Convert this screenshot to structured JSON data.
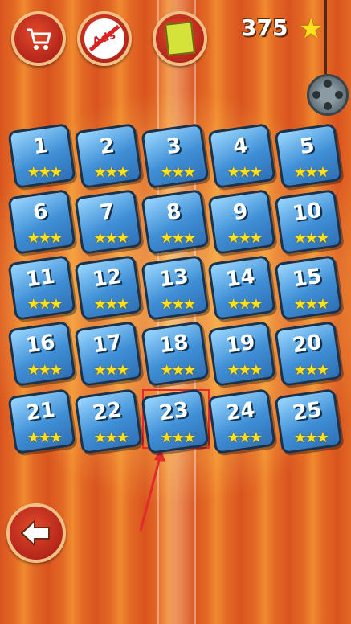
{
  "score": {
    "value": "375"
  },
  "topbar": {
    "shop_icon": "cart-icon",
    "ads_icon": "no-ads-icon",
    "ads_label": "Ads",
    "book_icon": "book-icon"
  },
  "levels": [
    {
      "num": "1",
      "stars": "★★★"
    },
    {
      "num": "2",
      "stars": "★★★"
    },
    {
      "num": "3",
      "stars": "★★★"
    },
    {
      "num": "4",
      "stars": "★★★"
    },
    {
      "num": "5",
      "stars": "★★★"
    },
    {
      "num": "6",
      "stars": "★★★"
    },
    {
      "num": "7",
      "stars": "★★★"
    },
    {
      "num": "8",
      "stars": "★★★"
    },
    {
      "num": "9",
      "stars": "★★★"
    },
    {
      "num": "10",
      "stars": "★★★"
    },
    {
      "num": "11",
      "stars": "★★★"
    },
    {
      "num": "12",
      "stars": "★★★"
    },
    {
      "num": "13",
      "stars": "★★★"
    },
    {
      "num": "14",
      "stars": "★★★"
    },
    {
      "num": "15",
      "stars": "★★★"
    },
    {
      "num": "16",
      "stars": "★★★"
    },
    {
      "num": "17",
      "stars": "★★★"
    },
    {
      "num": "18",
      "stars": "★★★"
    },
    {
      "num": "19",
      "stars": "★★★"
    },
    {
      "num": "20",
      "stars": "★★★"
    },
    {
      "num": "21",
      "stars": "★★★"
    },
    {
      "num": "22",
      "stars": "★★★"
    },
    {
      "num": "23",
      "stars": "★★★"
    },
    {
      "num": "24",
      "stars": "★★★"
    },
    {
      "num": "25",
      "stars": "★★★"
    }
  ],
  "highlighted_level": "23",
  "colors": {
    "highlight": "#e32b2b",
    "tile": "#3f8fd6",
    "star": "#ffe11b"
  }
}
